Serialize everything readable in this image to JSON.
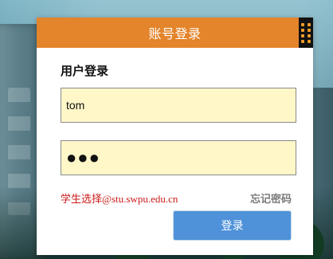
{
  "dialog": {
    "title": "账号登录"
  },
  "login": {
    "section_title": "用户登录",
    "username_value": "tom",
    "password_value": "●●●",
    "hint_text": "学生选择@stu.swpu.edu.cn",
    "forgot_password_label": "忘记密码",
    "login_button_label": "登录"
  },
  "colors": {
    "header": "#e4842b",
    "field_background": "#fff7c8",
    "hint_text": "#cc1b1b",
    "login_button": "#4f92d9"
  },
  "icons": {
    "header_menu": "grid-dots-icon"
  }
}
